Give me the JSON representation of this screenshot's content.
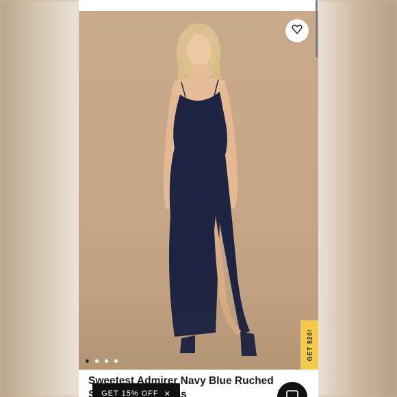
{
  "product": {
    "title": "Sweetest Admirer Navy Blue Ruched Strappy Maxi Dress",
    "image_alt": "Model wearing navy blue maxi dress",
    "carousel": {
      "count": 4,
      "active_index": 0
    }
  },
  "promo": {
    "tab_label": "GET $20!",
    "bar_label": "GET 15% OFF"
  },
  "icons": {
    "wishlist": "heart-icon",
    "close": "close-x-icon",
    "chat": "chat-icon"
  },
  "colors": {
    "promo_yellow": "#f2c94c",
    "dress_navy": "#1e2442",
    "background": "#c4a586"
  }
}
